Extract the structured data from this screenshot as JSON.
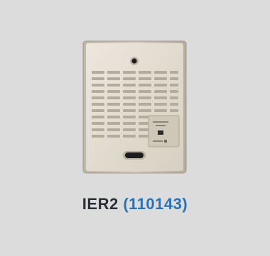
{
  "product": {
    "model": "IER2",
    "part_number": "(110143)",
    "image_icon": "door-station-speaker-icon",
    "colors": {
      "background": "#dcdcdc",
      "model_text": "#2b2f36",
      "part_number_text": "#2a72b8"
    }
  }
}
